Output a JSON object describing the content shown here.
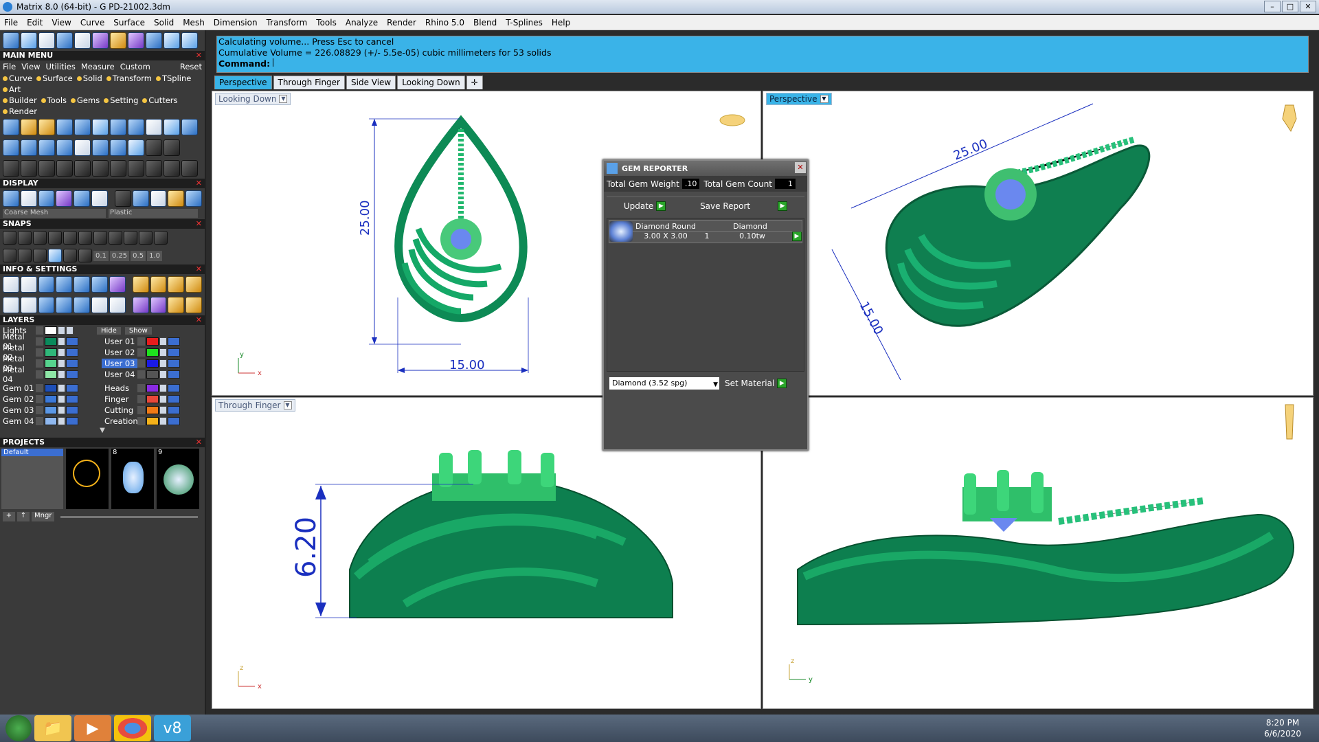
{
  "window": {
    "title": "Matrix 8.0 (64-bit) - G PD-21002.3dm"
  },
  "menu": [
    "File",
    "Edit",
    "View",
    "Curve",
    "Surface",
    "Solid",
    "Mesh",
    "Dimension",
    "Transform",
    "Tools",
    "Analyze",
    "Render",
    "Rhino 5.0",
    "Blend",
    "T-Splines",
    "Help"
  ],
  "main_menu": {
    "title": "MAIN MENU",
    "sub": [
      "File",
      "View",
      "Utilities",
      "Measure",
      "Custom"
    ],
    "reset": "Reset",
    "row1": [
      "Curve",
      "Surface",
      "Solid",
      "Transform",
      "TSpline",
      "Art"
    ],
    "row2": [
      "Builder",
      "Tools",
      "Gems",
      "Setting",
      "Cutters",
      "Render"
    ]
  },
  "display": {
    "title": "DISPLAY",
    "mesh": "Coarse Mesh",
    "material": "Plastic"
  },
  "snaps": {
    "title": "SNAPS",
    "values": [
      "0.1",
      "0.25",
      "0.5",
      "1.0"
    ]
  },
  "info": {
    "title": "INFO & SETTINGS"
  },
  "layers": {
    "title": "LAYERS",
    "lights": "Lights",
    "hide": "Hide",
    "show": "Show",
    "left": [
      {
        "name": "Metal 01",
        "color": "#0a8a5c"
      },
      {
        "name": "Metal 02",
        "color": "#2fb87a"
      },
      {
        "name": "Metal 03",
        "color": "#56d48e"
      },
      {
        "name": "Metal 04",
        "color": "#8ee6a6"
      },
      {
        "name": "Gem 01",
        "color": "#1d4fb8"
      },
      {
        "name": "Gem 02",
        "color": "#3b79d9"
      },
      {
        "name": "Gem 03",
        "color": "#5b98e6"
      },
      {
        "name": "Gem 04",
        "color": "#8fb8ef"
      }
    ],
    "right": [
      {
        "name": "User 01",
        "color": "#e81c1c"
      },
      {
        "name": "User 02",
        "color": "#1ee21e"
      },
      {
        "name": "User 03",
        "color": "#1a1ae6"
      },
      {
        "name": "User 04",
        "color": "#555555"
      },
      {
        "name": "Heads",
        "color": "#8a2be2"
      },
      {
        "name": "Finger",
        "color": "#e8483a"
      },
      {
        "name": "Cutting",
        "color": "#f07a16"
      },
      {
        "name": "Creation",
        "color": "#f5b21a"
      }
    ]
  },
  "projects": {
    "title": "PROJECTS",
    "default": "Default",
    "thumbs": [
      "",
      "8",
      "9"
    ],
    "mngr": "Mngr"
  },
  "command": {
    "line1": "Calculating volume... Press Esc to cancel",
    "line2": "Cumulative Volume = 226.08829 (+/- 5.5e-05) cubic millimeters for 53 solids",
    "prompt": "Command:"
  },
  "tabs": [
    "Perspective",
    "Through Finger",
    "Side View",
    "Looking Down"
  ],
  "viewports": {
    "top_left": {
      "label": "Looking Down",
      "dim_v": "25.00",
      "dim_h": "15.00",
      "axis1": "y",
      "axis2": "x"
    },
    "top_right": {
      "label": "Perspective",
      "dim_a": "25.00",
      "dim_b": "15.00"
    },
    "bottom_left": {
      "label": "Through Finger",
      "dim_v": "6.20",
      "axis1": "z",
      "axis2": "x"
    },
    "bottom_right": {
      "axis1": "z",
      "axis2": "y"
    }
  },
  "gem_reporter": {
    "title": "GEM REPORTER",
    "weight_label": "Total Gem Weight",
    "weight": ".10",
    "count_label": "Total Gem Count",
    "count": "1",
    "update": "Update",
    "save": "Save Report",
    "row": {
      "shape": "Diamond Round",
      "material": "Diamond",
      "size": "3.00 X 3.00",
      "qty": "1",
      "tw": "0.10tw"
    },
    "material_select": "Diamond      (3.52 spg)",
    "set_material": "Set Material"
  },
  "clock": {
    "time": "8:20 PM",
    "date": "6/6/2020"
  }
}
